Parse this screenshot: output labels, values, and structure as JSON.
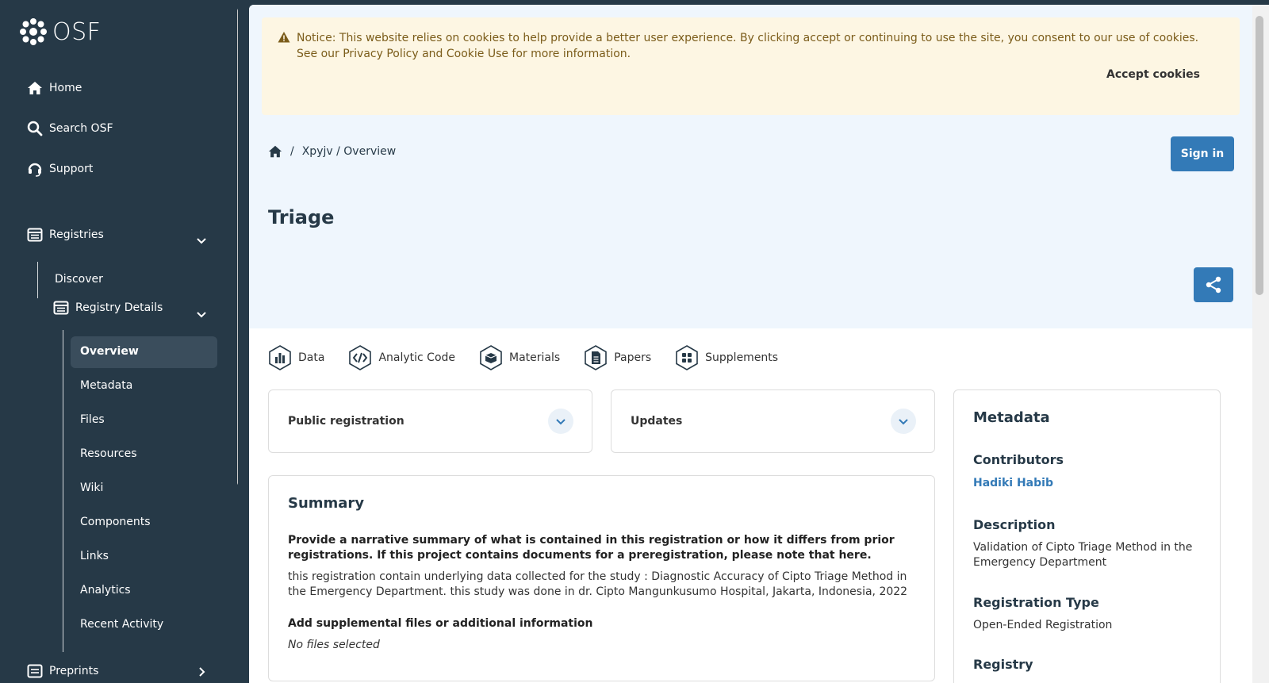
{
  "sidebar": {
    "logo_text": "OSF",
    "primary": [
      {
        "label": "Home",
        "icon": "home-icon"
      },
      {
        "label": "Search OSF",
        "icon": "search-icon"
      },
      {
        "label": "Support",
        "icon": "headset-icon"
      }
    ],
    "registries": {
      "label": "Registries",
      "icon": "registries-icon"
    },
    "discover": "Discover",
    "registry_details": {
      "label": "Registry Details",
      "icon": "registries-icon"
    },
    "details_items": [
      "Overview",
      "Metadata",
      "Files",
      "Resources",
      "Wiki",
      "Components",
      "Links",
      "Analytics",
      "Recent Activity"
    ],
    "active_item": "Overview",
    "preprints": {
      "label": "Preprints",
      "icon": "preprints-icon"
    }
  },
  "notice": {
    "text": "Notice: This website relies on cookies to help provide a better user experience. By clicking accept or continuing to use the site, you consent to our use of cookies. See our Privacy Policy and Cookie Use for more information.",
    "accept_label": "Accept cookies"
  },
  "breadcrumb": {
    "separator": "/",
    "path": "Xpyjv / Overview"
  },
  "signin_label": "Sign in",
  "page_title": "Triage",
  "tabs": [
    {
      "label": "Data",
      "icon": "data-badge-icon"
    },
    {
      "label": "Analytic Code",
      "icon": "code-badge-icon"
    },
    {
      "label": "Materials",
      "icon": "materials-badge-icon"
    },
    {
      "label": "Papers",
      "icon": "papers-badge-icon"
    },
    {
      "label": "Supplements",
      "icon": "supplements-badge-icon"
    }
  ],
  "cards": {
    "public_registration": "Public registration",
    "updates": "Updates"
  },
  "summary": {
    "heading": "Summary",
    "question": "Provide a narrative summary of what is contained in this registration or how it differs from prior registrations. If this project contains documents for a preregistration, please note that here.",
    "answer": "this registration contain underlying data collected for the study : Diagnostic Accuracy of Cipto Triage Method in the Emergency Department. this study was done in dr. Cipto Mangunkusumo Hospital, Jakarta, Indonesia, 2022",
    "add_label": "Add supplemental files or additional information",
    "no_files": "No files selected"
  },
  "metadata": {
    "heading": "Metadata",
    "contributors_label": "Contributors",
    "contributor": "Hadiki Habib",
    "description_label": "Description",
    "description": "Validation of Cipto Triage Method in the Emergency Department",
    "type_label": "Registration Type",
    "type": "Open-Ended Registration",
    "registry_label": "Registry"
  },
  "colors": {
    "sidebar": "#263947",
    "accent": "#337ab7",
    "notice_bg": "#fdf6e3",
    "hero_bg": "#eff6fd"
  }
}
